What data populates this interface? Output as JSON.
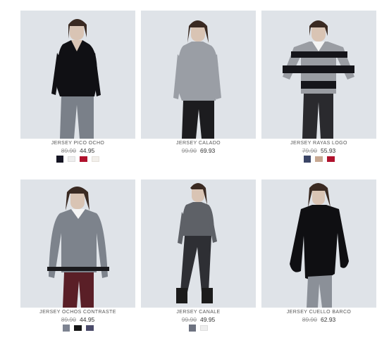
{
  "products": [
    {
      "name": "JERSEY PICO OCHO",
      "old_price": "89.90",
      "price": "44.95",
      "swatches": [
        {
          "name": "black",
          "color": "#151523"
        },
        {
          "name": "white-pattern",
          "color": "#eeeeee"
        },
        {
          "name": "red",
          "color": "#b0122d"
        },
        {
          "name": "cream",
          "color": "#f2efea"
        }
      ]
    },
    {
      "name": "JERSEY CALADO",
      "old_price": "99.90",
      "price": "69.93",
      "swatches": []
    },
    {
      "name": "JERSEY RAYAS LOGO",
      "old_price": "79.90",
      "price": "55.93",
      "swatches": [
        {
          "name": "navy-pattern",
          "color": "#3b4566"
        },
        {
          "name": "beige",
          "color": "#c7a892"
        },
        {
          "name": "red",
          "color": "#b0122d"
        }
      ]
    },
    {
      "name": "JERSEY OCHOS CONTRASTE",
      "old_price": "89.90",
      "price": "44.95",
      "swatches": [
        {
          "name": "grey-pattern",
          "color": "#7d8391"
        },
        {
          "name": "black",
          "color": "#151515"
        },
        {
          "name": "navy",
          "color": "#4a4a69"
        }
      ]
    },
    {
      "name": "JERSEY CANALE",
      "old_price": "99.90",
      "price": "49.95",
      "swatches": [
        {
          "name": "grey-pattern",
          "color": "#6d7280"
        },
        {
          "name": "light-pattern",
          "color": "#eeeeee"
        }
      ]
    },
    {
      "name": "JERSEY CUELLO BARCO",
      "old_price": "89.90",
      "price": "62.93",
      "swatches": []
    }
  ]
}
